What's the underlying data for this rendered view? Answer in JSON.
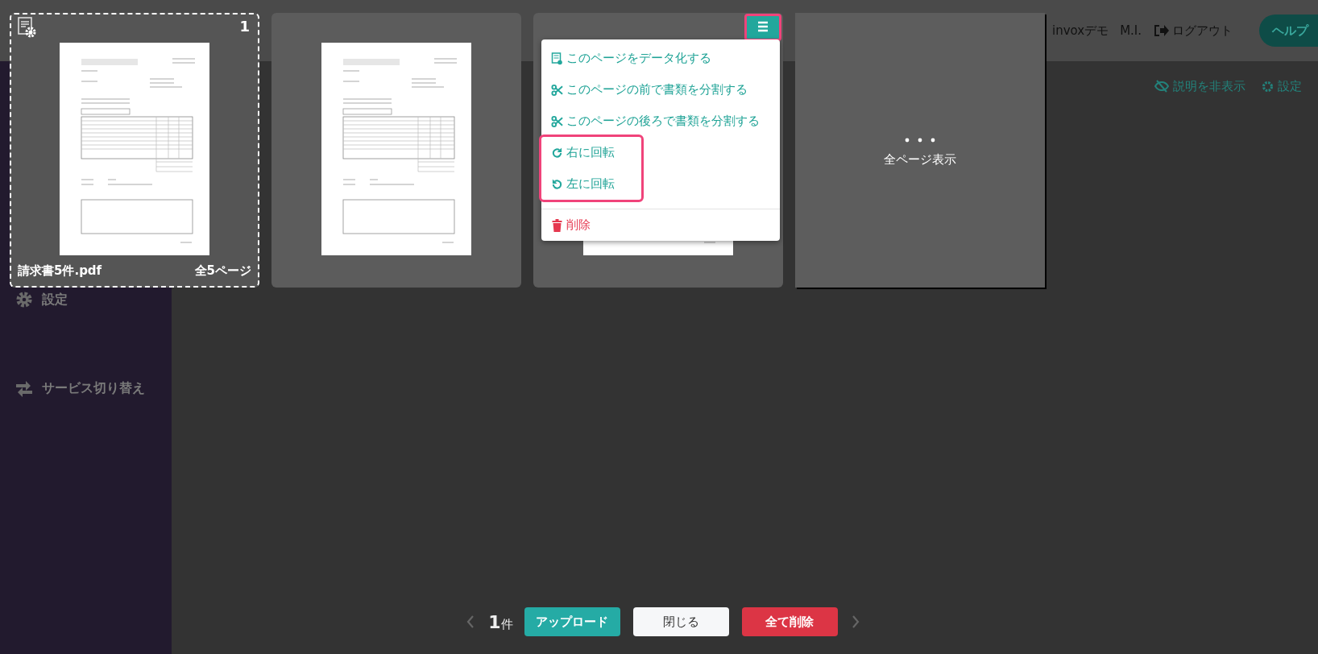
{
  "app": {
    "company": "invoxデモ",
    "user": "M.I.",
    "logout": "ログアウト",
    "help": "ヘルプ"
  },
  "sidebar": {
    "items": [
      {
        "label": "設定"
      },
      {
        "label": "サービス切り替え"
      }
    ]
  },
  "page": {
    "hide_help": "説明を非表示",
    "settings": "設定"
  },
  "viewer": {
    "pages": [
      {
        "number": "1",
        "selected": true,
        "file_name": "請求書5件.pdf",
        "page_count": "全5ページ",
        "menu_open": false
      },
      {
        "selected": false,
        "menu_open": false
      },
      {
        "selected": false,
        "menu_open": true,
        "menu_button_highlighted": true
      }
    ],
    "more_label": "全ページ表示",
    "menu": {
      "items": [
        {
          "kind": "data",
          "label": "このページをデータ化する",
          "highlighted": false
        },
        {
          "kind": "split",
          "label": "このページの前で書類を分割する",
          "highlighted": false
        },
        {
          "kind": "split",
          "label": "このページの後ろで書類を分割する",
          "highlighted": false
        },
        {
          "kind": "rotate_right",
          "label": "右に回転",
          "highlighted": true
        },
        {
          "kind": "rotate_left",
          "label": "左に回転",
          "highlighted": true
        },
        {
          "kind": "delete",
          "label": "削除",
          "highlighted": false
        }
      ]
    },
    "count": "1",
    "count_unit": "件",
    "buttons": [
      {
        "kind": "primary",
        "label": "アップロード"
      },
      {
        "kind": "secondary",
        "label": "閉じる"
      },
      {
        "kind": "danger",
        "label": "全て削除"
      }
    ]
  }
}
